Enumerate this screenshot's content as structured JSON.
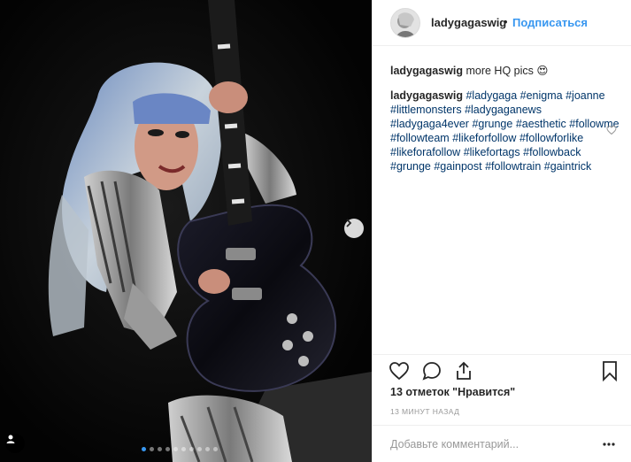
{
  "header": {
    "username": "ladygagaswig",
    "separator": "•",
    "follow_label": "Подписаться"
  },
  "post": {
    "caption_user": "ladygagaswig",
    "caption_text": "more HQ pics 😍",
    "comment_user": "ladygagaswig",
    "hashtags": [
      "#ladygaga",
      "#enigma",
      "#joanne",
      "#littlemonsters",
      "#ladygaganews",
      "#ladygaga4ever",
      "#grunge",
      "#aesthetic",
      "#followme",
      "#followteam",
      "#likeforfollow",
      "#followforlike",
      "#likeforafollow",
      "#likefortags",
      "#followback",
      "#grunge",
      "#gainpost",
      "#followtrain",
      "#gaintrick"
    ],
    "likes_text": "13 отметок \"Нравится\"",
    "time_text": "13 МИНУТ НАЗАД",
    "add_comment_placeholder": "Добавьте комментарий...",
    "more_label": "•••"
  },
  "carousel": {
    "dot_count": 10,
    "active_index": 0
  },
  "icons": {
    "like": "heart-icon",
    "comment": "comment-icon",
    "share": "share-icon",
    "save": "bookmark-icon",
    "next": "chevron-right-icon",
    "tag": "user-icon"
  },
  "colors": {
    "link": "#3897f0",
    "hashtag": "#003569",
    "muted": "#999999",
    "border": "#efefef"
  }
}
